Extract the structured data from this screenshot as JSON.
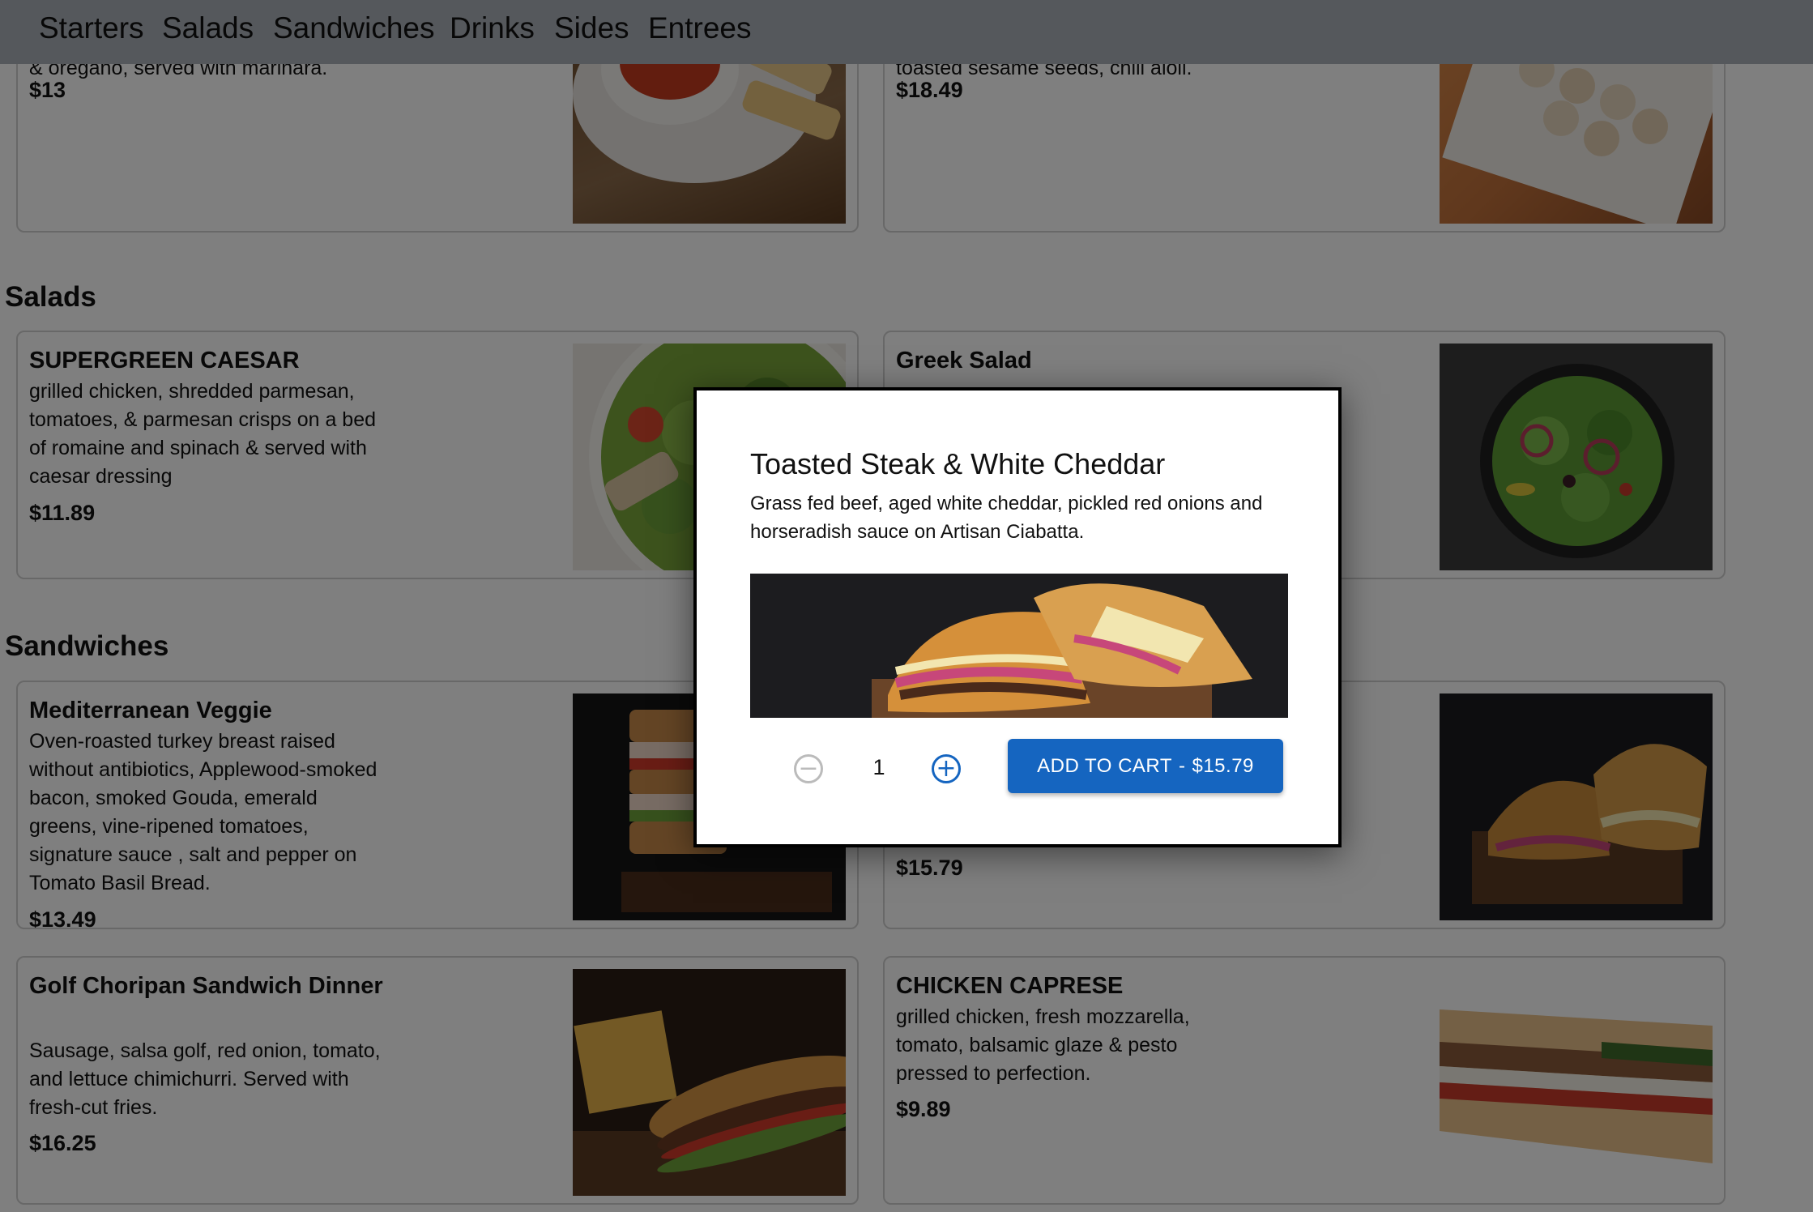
{
  "nav": {
    "items": [
      {
        "label": "Starters"
      },
      {
        "label": "Salads"
      },
      {
        "label": "Sandwiches"
      },
      {
        "label": "Drinks"
      },
      {
        "label": "Sides"
      },
      {
        "label": "Entrees"
      }
    ]
  },
  "starters": {
    "cards": [
      {
        "desc": "& oregano, served with marinara.",
        "price": "$13"
      },
      {
        "desc": "toasted sesame seeds, chili aioli.",
        "price": "$18.49"
      }
    ]
  },
  "salads": {
    "title": "Salads",
    "cards": [
      {
        "name": "SUPERGREEN CAESAR",
        "desc": "grilled chicken, shredded parmesan, tomatoes, & parmesan crisps on a bed of romaine and spinach & served with caesar dressing",
        "price": "$11.89"
      },
      {
        "name": "Greek Salad",
        "desc": "",
        "price": ""
      }
    ]
  },
  "sandwiches": {
    "title": "Sandwiches",
    "cards": [
      {
        "name": "Mediterranean Veggie",
        "desc": "Oven-roasted turkey breast raised without antibiotics, Applewood-smoked bacon, smoked Gouda, emerald greens, vine-ripened tomatoes, signature sauce , salt and pepper on Tomato Basil Bread.",
        "price": "$13.49"
      },
      {
        "name": "",
        "desc": "",
        "price": "$15.79"
      },
      {
        "name": "Golf Choripan Sandwich Dinner",
        "desc": "Sausage, salsa golf, red onion, tomato, and lettuce chimichurri. Served with fresh-cut fries.",
        "price": "$16.25"
      },
      {
        "name": "CHICKEN CAPRESE",
        "desc": "grilled chicken, fresh mozzarella, tomato, balsamic glaze & pesto pressed to perfection.",
        "price": "$9.89"
      }
    ]
  },
  "modal": {
    "title": "Toasted Steak & White Cheddar",
    "description": "Grass fed beef, aged white cheddar, pickled red onions and horseradish sauce on Artisan Ciabatta.",
    "quantity": "1",
    "minus_icon": "minus-circle-icon",
    "plus_icon": "plus-circle-icon",
    "add_label": "ADD TO CART",
    "separator": "-",
    "add_price": "$15.79"
  },
  "colors": {
    "primary": "#1565c0",
    "nav_bg": "#aab0b8",
    "overlay": "rgba(0,0,0,0.5)"
  }
}
